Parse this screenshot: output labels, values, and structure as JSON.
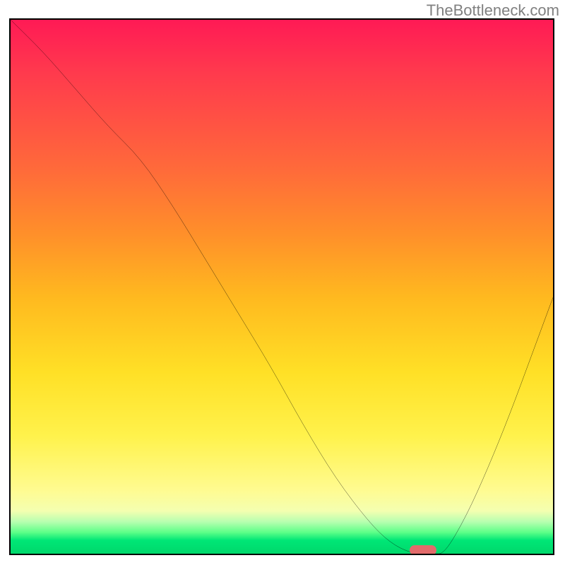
{
  "watermark": "TheBottleneck.com",
  "colors": {
    "gradient_top": "#ff1a55",
    "gradient_mid1": "#ff8f2a",
    "gradient_mid2": "#ffe026",
    "gradient_bottom": "#00d86b",
    "curve": "#000000",
    "marker": "#e26b6b",
    "border": "#000000"
  },
  "chart_data": {
    "type": "line",
    "title": "",
    "xlabel": "",
    "ylabel": "",
    "xlim": [
      0,
      100
    ],
    "ylim": [
      0,
      100
    ],
    "note": "Background vertical gradient maps y (high=red, low=green). Curve is a V-shaped bottleneck curve; values estimated from pixels.",
    "series": [
      {
        "name": "bottleneck-curve",
        "x": [
          0,
          6,
          12,
          18,
          24,
          30,
          36,
          42,
          48,
          54,
          60,
          66,
          70,
          74,
          78,
          80,
          84,
          88,
          92,
          96,
          100
        ],
        "y": [
          100,
          94,
          87,
          80,
          74,
          65,
          55,
          45,
          35,
          24,
          14,
          6,
          2,
          0,
          0,
          0,
          7,
          16,
          26,
          37,
          48
        ]
      }
    ],
    "marker": {
      "x": 76,
      "y": 0,
      "shape": "rounded-rect"
    }
  }
}
